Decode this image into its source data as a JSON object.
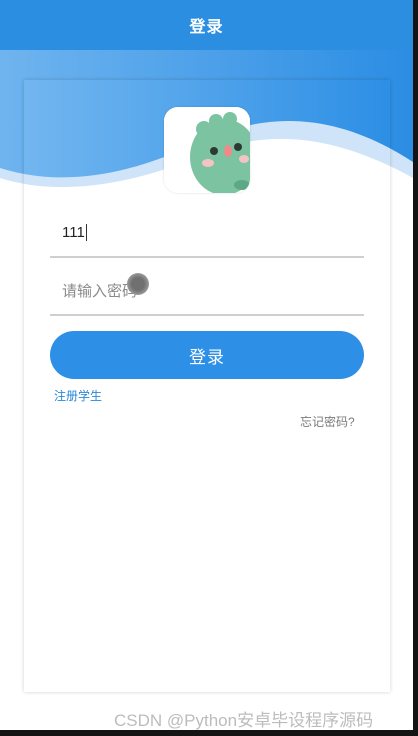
{
  "header": {
    "title": "登录"
  },
  "form": {
    "username_value": "111",
    "password_placeholder": "请输入密码",
    "login_label": "登录",
    "register_label": "注册学生",
    "forgot_label": "忘记密码?"
  },
  "watermark": {
    "text": "CSDN @Python安卓毕设程序源码"
  },
  "colors": {
    "primary": "#2c8ee0",
    "button": "#2d8fe5",
    "link": "#2a86d8"
  },
  "icons": {
    "avatar": "cartoon-dinosaur-icon"
  }
}
